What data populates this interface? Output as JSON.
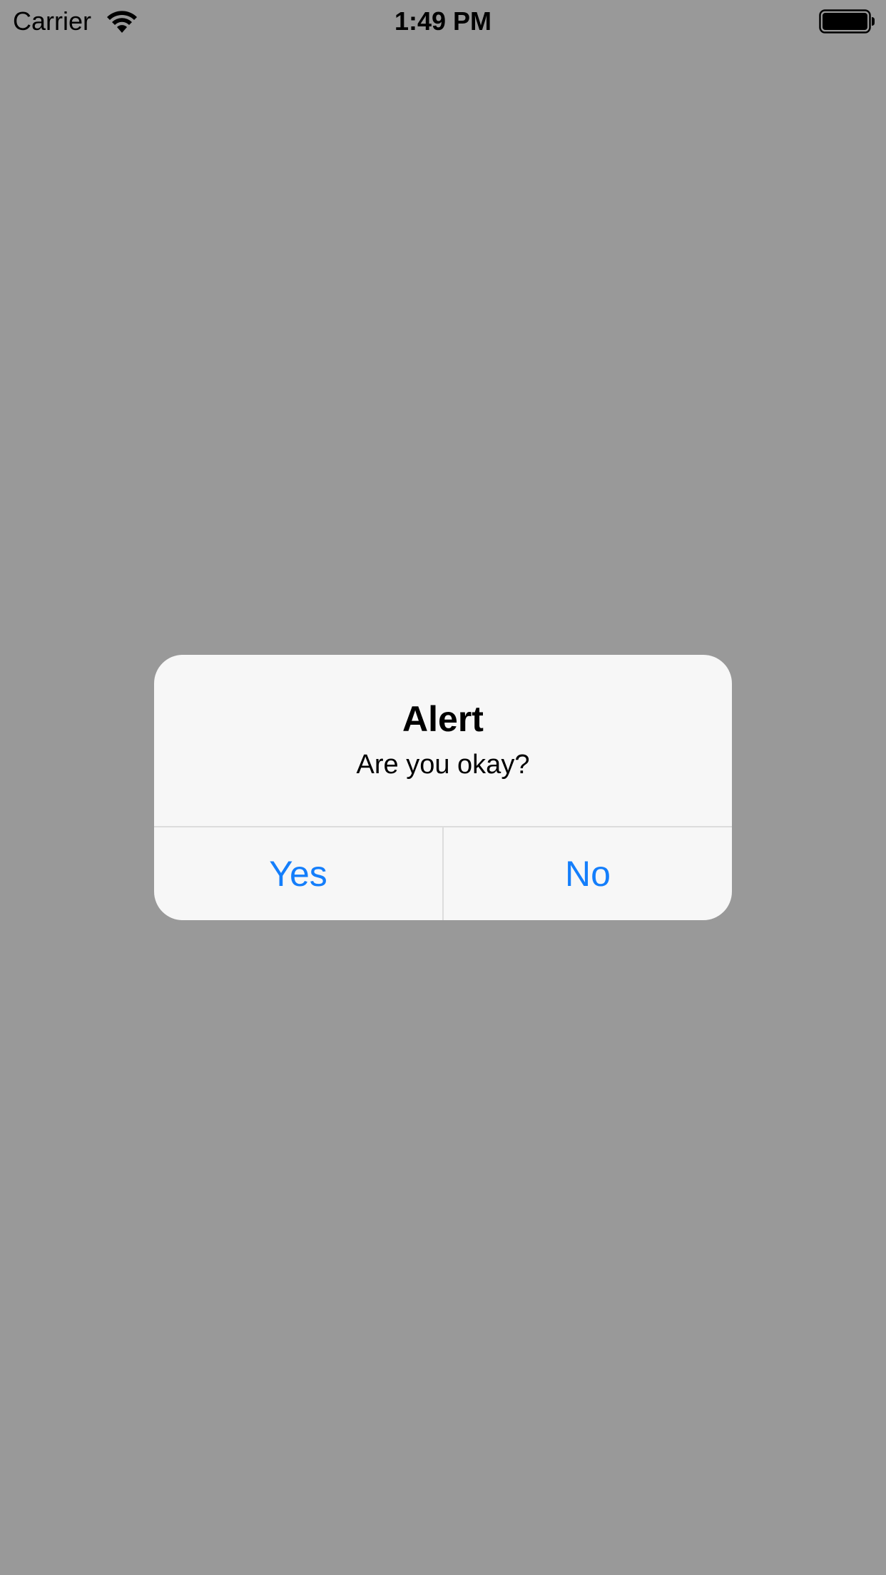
{
  "status_bar": {
    "carrier": "Carrier",
    "time": "1:49 PM",
    "wifi_icon": "wifi-icon",
    "battery_icon": "battery-icon"
  },
  "alert": {
    "title": "Alert",
    "message": "Are you okay?",
    "buttons": [
      {
        "label": "Yes"
      },
      {
        "label": "No"
      }
    ]
  },
  "colors": {
    "backdrop": "#999999",
    "alert_background": "#f7f7f7",
    "button_text": "#147efb",
    "divider": "#dcdcdc"
  }
}
